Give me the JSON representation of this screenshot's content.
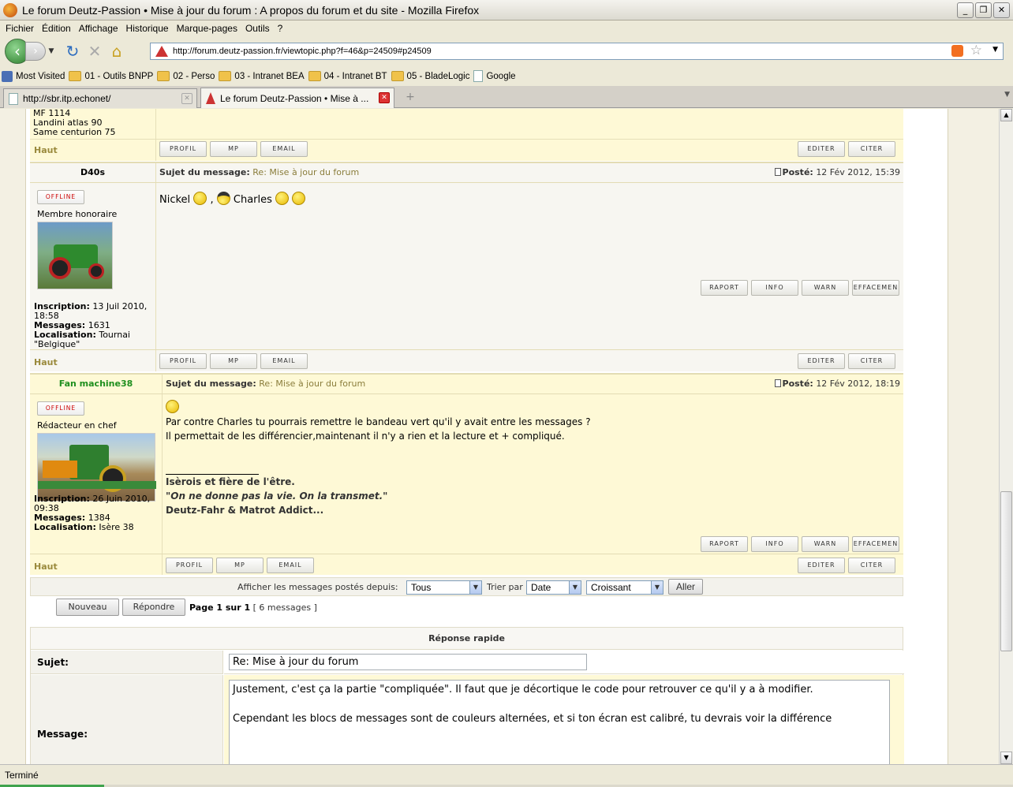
{
  "window": {
    "title": "Le forum Deutz-Passion • Mise à jour du forum : A propos du forum et du site - Mozilla Firefox",
    "buttons": [
      "_",
      "❐",
      "✕"
    ]
  },
  "menu": [
    "Fichier",
    "Édition",
    "Affichage",
    "Historique",
    "Marque-pages",
    "Outils",
    "?"
  ],
  "nav": {
    "url": "http://forum.deutz-passion.fr/viewtopic.php?f=46&p=24509#p24509"
  },
  "bookmarks": [
    {
      "label": "Most Visited",
      "icon": "star-bookmark-icon"
    },
    {
      "label": "01 - Outils BNPP",
      "icon": "folder-icon"
    },
    {
      "label": "02 - Perso",
      "icon": "folder-icon"
    },
    {
      "label": "03 - Intranet BEA",
      "icon": "folder-icon"
    },
    {
      "label": "04 - Intranet BT",
      "icon": "folder-icon"
    },
    {
      "label": "05 - BladeLogic",
      "icon": "folder-icon"
    },
    {
      "label": "Google",
      "icon": "page-icon"
    }
  ],
  "tabs": [
    {
      "label": "http://sbr.itp.echonet/",
      "active": false
    },
    {
      "label": "Le forum Deutz-Passion • Mise à ...",
      "active": true
    }
  ],
  "prev_post": {
    "profile_lines": [
      "MF 1114",
      "Landini atlas 90",
      "Same centurion 75"
    ],
    "haut": "Haut",
    "buttons": {
      "profil": "PROFIL",
      "mp": "MP",
      "email": "EMAIL",
      "editer": "EDITER",
      "citer": "CITER"
    }
  },
  "posts": [
    {
      "author": "D40s",
      "author_color": "#000000",
      "subject_label": "Sujet du message:",
      "subject": "Re: Mise à jour du forum",
      "posted_label": "Posté:",
      "posted": "12 Fév 2012, 15:39",
      "status": "OFFLINE",
      "rank": "Membre honoraire",
      "body_nickel": "Nickel",
      "body_comma": ",",
      "body_charles": "Charles",
      "inscription_label": "Inscription:",
      "inscription": "13 Juil 2010, 18:58",
      "messages_label": "Messages:",
      "messages": "1631",
      "localisation_label": "Localisation:",
      "localisation": "Tournai \"Belgique\"",
      "action_buttons": {
        "raport": "RAPORT",
        "info": "INFO",
        "warn": "WARN",
        "effacement": "EFFACEMEN"
      },
      "haut": "Haut",
      "buttons": {
        "profil": "PROFIL",
        "mp": "MP",
        "email": "EMAIL",
        "editer": "EDITER",
        "citer": "CITER"
      }
    },
    {
      "author": "Fan machine38",
      "author_color": "#1f8f1f",
      "subject_label": "Sujet du message:",
      "subject": "Re: Mise à jour du forum",
      "posted_label": "Posté:",
      "posted": "12 Fév 2012, 18:19",
      "status": "OFFLINE",
      "rank": "Rédacteur en chef",
      "body_line1": "Par contre Charles tu pourrais remettre le bandeau vert qu'il y avait entre les messages ?",
      "body_line2": "Il permettait de les différencier,maintenant il n'y a rien et la lecture et + compliqué.",
      "sig_line1": "Isèrois et fière de l'être.",
      "sig_line2": "\"On ne donne pas la vie. On la transmet.\"",
      "sig_line3": "Deutz-Fahr & Matrot Addict...",
      "inscription_label": "Inscription:",
      "inscription": "26 Juin 2010, 09:38",
      "messages_label": "Messages:",
      "messages": "1384",
      "localisation_label": "Localisation:",
      "localisation": "Isère 38",
      "action_buttons": {
        "raport": "RAPORT",
        "info": "INFO",
        "warn": "WARN",
        "effacement": "EFFACEMEN"
      },
      "haut": "Haut",
      "buttons": {
        "profil": "PROFIL",
        "mp": "MP",
        "email": "EMAIL",
        "editer": "EDITER",
        "citer": "CITER"
      }
    }
  ],
  "filter": {
    "label": "Afficher les messages postés depuis:",
    "since_value": "Tous",
    "sort_label": "Trier par",
    "sort_value": "Date",
    "order_value": "Croissant",
    "go": "Aller"
  },
  "pagination": {
    "new_label": "Nouveau",
    "reply_label": "Répondre",
    "page_text": "Page 1 sur 1",
    "count_text": "[ 6 messages ]"
  },
  "quick_reply": {
    "title": "Réponse rapide",
    "subject_label": "Sujet:",
    "subject_value": "Re: Mise à jour du forum",
    "message_label": "Message:",
    "message_line1": "Justement, c'est ça la partie \"compliquée\". Il faut que je décortique le code pour retrouver ce qu'il y a à modifier.",
    "message_line2": "Cependant les blocs de messages sont de couleurs alternées, et si ton écran est calibré, tu devrais voir la différence"
  },
  "status_bar": "Terminé"
}
